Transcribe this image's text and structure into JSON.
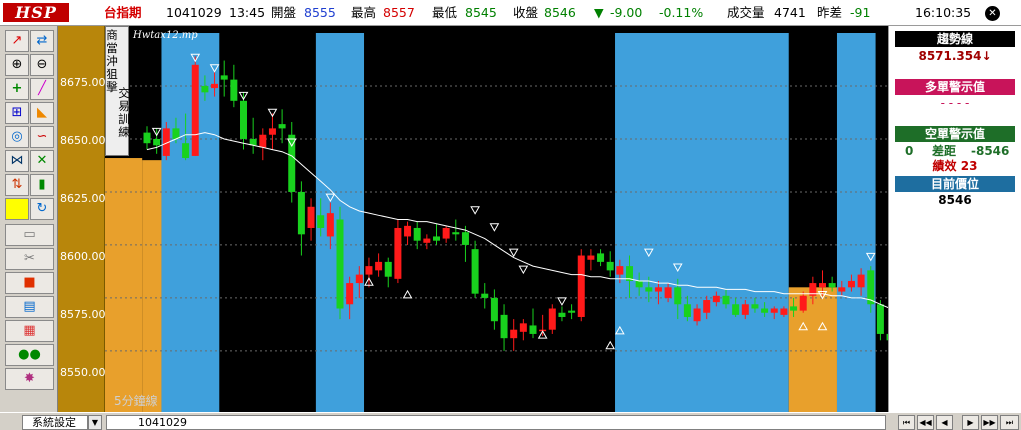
{
  "header": {
    "logo": "HSP",
    "symbol": "台指期",
    "date": "1041029",
    "time": "13:45",
    "open_label": "開盤",
    "open_value": "8555",
    "high_label": "最高",
    "high_value": "8557",
    "low_label": "最低",
    "low_value": "8545",
    "close_label": "收盤",
    "close_value": "8546",
    "change_arrow": "▼",
    "change": "-9.00",
    "change_pct": "-0.11%",
    "volume_label": "成交量",
    "volume_value": "4741",
    "prev_diff_label": "昨差",
    "prev_diff_value": "-91",
    "clock": "16:10:35",
    "close_symbol": "✕"
  },
  "toolbar": {
    "icons": [
      "trend-line-icon",
      "sync-icon",
      "zoom-in-icon",
      "zoom-out-icon",
      "crosshair-icon",
      "line-draw-icon",
      "fibonacci-icon",
      "rectangle-icon",
      "wave-icon",
      "curve-icon",
      "channel-icon",
      "cross-lines-icon",
      "up-down-arrow-icon",
      "candle-icon",
      "color-swatch-icon",
      "refresh-icon",
      "folder-icon",
      "scissors-icon",
      "square-icon",
      "report-icon",
      "grid-icon",
      "users-icon",
      "flash-icon"
    ],
    "yellow_color": "#ffff00"
  },
  "side_menu": {
    "col1": "商當沖狙擊",
    "col2": "交易訓練"
  },
  "chart": {
    "file_label": "Hwtax12.mp",
    "period_label": "5分鐘線",
    "y_ticks": [
      "8675.00",
      "8650.00",
      "8625.00",
      "8600.00",
      "8575.00",
      "8550.00"
    ]
  },
  "chart_data": {
    "type": "candlestick",
    "ylim": [
      8535,
      8700
    ],
    "y_ticks": [
      8675,
      8650,
      8625,
      8600,
      8575,
      8550
    ],
    "candles": [
      {
        "o": 8653,
        "h": 8656,
        "l": 8645,
        "c": 8648
      },
      {
        "o": 8650,
        "h": 8655,
        "l": 8643,
        "c": 8647
      },
      {
        "o": 8642,
        "h": 8658,
        "l": 8640,
        "c": 8655
      },
      {
        "o": 8655,
        "h": 8660,
        "l": 8648,
        "c": 8650
      },
      {
        "o": 8648,
        "h": 8662,
        "l": 8640,
        "c": 8641
      },
      {
        "o": 8642,
        "h": 8689,
        "l": 8642,
        "c": 8685
      },
      {
        "o": 8675,
        "h": 8680,
        "l": 8668,
        "c": 8672
      },
      {
        "o": 8674,
        "h": 8682,
        "l": 8670,
        "c": 8676
      },
      {
        "o": 8680,
        "h": 8687,
        "l": 8670,
        "c": 8678
      },
      {
        "o": 8678,
        "h": 8685,
        "l": 8665,
        "c": 8668
      },
      {
        "o": 8668,
        "h": 8672,
        "l": 8645,
        "c": 8650
      },
      {
        "o": 8650,
        "h": 8660,
        "l": 8643,
        "c": 8647
      },
      {
        "o": 8646,
        "h": 8655,
        "l": 8640,
        "c": 8652
      },
      {
        "o": 8652,
        "h": 8662,
        "l": 8645,
        "c": 8655
      },
      {
        "o": 8657,
        "h": 8664,
        "l": 8648,
        "c": 8655
      },
      {
        "o": 8652,
        "h": 8658,
        "l": 8620,
        "c": 8625
      },
      {
        "o": 8625,
        "h": 8630,
        "l": 8595,
        "c": 8605
      },
      {
        "o": 8608,
        "h": 8622,
        "l": 8602,
        "c": 8618
      },
      {
        "o": 8614,
        "h": 8622,
        "l": 8604,
        "c": 8608
      },
      {
        "o": 8604,
        "h": 8620,
        "l": 8598,
        "c": 8615
      },
      {
        "o": 8612,
        "h": 8618,
        "l": 8565,
        "c": 8570
      },
      {
        "o": 8572,
        "h": 8585,
        "l": 8565,
        "c": 8582
      },
      {
        "o": 8582,
        "h": 8590,
        "l": 8575,
        "c": 8586
      },
      {
        "o": 8586,
        "h": 8594,
        "l": 8580,
        "c": 8590
      },
      {
        "o": 8588,
        "h": 8596,
        "l": 8585,
        "c": 8592
      },
      {
        "o": 8592,
        "h": 8594,
        "l": 8580,
        "c": 8585
      },
      {
        "o": 8584,
        "h": 8612,
        "l": 8582,
        "c": 8608
      },
      {
        "o": 8604,
        "h": 8611,
        "l": 8600,
        "c": 8609
      },
      {
        "o": 8608,
        "h": 8611,
        "l": 8598,
        "c": 8602
      },
      {
        "o": 8601,
        "h": 8605,
        "l": 8598,
        "c": 8603
      },
      {
        "o": 8604,
        "h": 8610,
        "l": 8600,
        "c": 8602
      },
      {
        "o": 8603,
        "h": 8609,
        "l": 8601,
        "c": 8608
      },
      {
        "o": 8606,
        "h": 8612,
        "l": 8602,
        "c": 8605
      },
      {
        "o": 8606,
        "h": 8609,
        "l": 8592,
        "c": 8600
      },
      {
        "o": 8598,
        "h": 8602,
        "l": 8575,
        "c": 8577
      },
      {
        "o": 8577,
        "h": 8582,
        "l": 8570,
        "c": 8575
      },
      {
        "o": 8575,
        "h": 8579,
        "l": 8560,
        "c": 8564
      },
      {
        "o": 8567,
        "h": 8572,
        "l": 8550,
        "c": 8556
      },
      {
        "o": 8556,
        "h": 8565,
        "l": 8550,
        "c": 8560
      },
      {
        "o": 8559,
        "h": 8565,
        "l": 8555,
        "c": 8563
      },
      {
        "o": 8562,
        "h": 8570,
        "l": 8556,
        "c": 8558
      },
      {
        "o": 8560,
        "h": 8567,
        "l": 8557,
        "c": 8560
      },
      {
        "o": 8560,
        "h": 8572,
        "l": 8558,
        "c": 8570
      },
      {
        "o": 8568,
        "h": 8571,
        "l": 8564,
        "c": 8566
      },
      {
        "o": 8569,
        "h": 8572,
        "l": 8565,
        "c": 8568
      },
      {
        "o": 8566,
        "h": 8598,
        "l": 8564,
        "c": 8595
      },
      {
        "o": 8593,
        "h": 8598,
        "l": 8588,
        "c": 8595
      },
      {
        "o": 8596,
        "h": 8598,
        "l": 8590,
        "c": 8592
      },
      {
        "o": 8592,
        "h": 8597,
        "l": 8585,
        "c": 8588
      },
      {
        "o": 8586,
        "h": 8593,
        "l": 8582,
        "c": 8590
      },
      {
        "o": 8590,
        "h": 8595,
        "l": 8575,
        "c": 8583
      },
      {
        "o": 8583,
        "h": 8587,
        "l": 8576,
        "c": 8580
      },
      {
        "o": 8580,
        "h": 8585,
        "l": 8573,
        "c": 8578
      },
      {
        "o": 8578,
        "h": 8583,
        "l": 8572,
        "c": 8580
      },
      {
        "o": 8575,
        "h": 8582,
        "l": 8573,
        "c": 8580
      },
      {
        "o": 8580,
        "h": 8584,
        "l": 8565,
        "c": 8572
      },
      {
        "o": 8572,
        "h": 8576,
        "l": 8564,
        "c": 8566
      },
      {
        "o": 8564,
        "h": 8572,
        "l": 8562,
        "c": 8570
      },
      {
        "o": 8568,
        "h": 8576,
        "l": 8565,
        "c": 8574
      },
      {
        "o": 8573,
        "h": 8578,
        "l": 8571,
        "c": 8576
      },
      {
        "o": 8576,
        "h": 8579,
        "l": 8570,
        "c": 8572
      },
      {
        "o": 8572,
        "h": 8575,
        "l": 8566,
        "c": 8567
      },
      {
        "o": 8567,
        "h": 8574,
        "l": 8565,
        "c": 8572
      },
      {
        "o": 8572,
        "h": 8575,
        "l": 8568,
        "c": 8570
      },
      {
        "o": 8570,
        "h": 8573,
        "l": 8566,
        "c": 8568
      },
      {
        "o": 8568,
        "h": 8571,
        "l": 8565,
        "c": 8570
      },
      {
        "o": 8567,
        "h": 8571,
        "l": 8566,
        "c": 8570
      },
      {
        "o": 8571,
        "h": 8575,
        "l": 8566,
        "c": 8569
      },
      {
        "o": 8569,
        "h": 8578,
        "l": 8568,
        "c": 8576
      },
      {
        "o": 8576,
        "h": 8585,
        "l": 8572,
        "c": 8582
      },
      {
        "o": 8580,
        "h": 8588,
        "l": 8576,
        "c": 8582
      },
      {
        "o": 8582,
        "h": 8585,
        "l": 8578,
        "c": 8580
      },
      {
        "o": 8578,
        "h": 8583,
        "l": 8576,
        "c": 8580
      },
      {
        "o": 8580,
        "h": 8586,
        "l": 8578,
        "c": 8583
      },
      {
        "o": 8580,
        "h": 8589,
        "l": 8576,
        "c": 8586
      },
      {
        "o": 8588,
        "h": 8590,
        "l": 8568,
        "c": 8572
      },
      {
        "o": 8572,
        "h": 8574,
        "l": 8555,
        "c": 8558
      },
      {
        "o": 8558,
        "h": 8562,
        "l": 8550,
        "c": 8555
      },
      {
        "o": 8555,
        "h": 8557,
        "l": 8545,
        "c": 8546
      }
    ],
    "zones": [
      {
        "from": 0,
        "to": 1,
        "color": "#e8a02c",
        "base": 8640
      },
      {
        "from": 2,
        "to": 7,
        "color": "#3fa0dc",
        "base": 8700
      },
      {
        "from": 8,
        "to": 17,
        "color": "#000000",
        "base": 8700
      },
      {
        "from": 18,
        "to": 22,
        "color": "#3fa0dc",
        "base": 8700
      },
      {
        "from": 23,
        "to": 48,
        "color": "#000000",
        "base": 8700
      },
      {
        "from": 49,
        "to": 66,
        "color": "#3fa0dc",
        "base": 8700
      },
      {
        "from": 67,
        "to": 71,
        "color": "#e8a02c",
        "base": 8580
      },
      {
        "from": 72,
        "to": 75,
        "color": "#3fa0dc",
        "base": 8700
      }
    ],
    "sell_markers": [
      {
        "i": 1,
        "v": 8655
      },
      {
        "i": 5,
        "v": 8690
      },
      {
        "i": 7,
        "v": 8685
      },
      {
        "i": 10,
        "v": 8672
      },
      {
        "i": 13,
        "v": 8664
      },
      {
        "i": 15,
        "v": 8650
      },
      {
        "i": 19,
        "v": 8624
      },
      {
        "i": 34,
        "v": 8618
      },
      {
        "i": 36,
        "v": 8610
      },
      {
        "i": 38,
        "v": 8598
      },
      {
        "i": 39,
        "v": 8590
      },
      {
        "i": 43,
        "v": 8575
      },
      {
        "i": 52,
        "v": 8598
      },
      {
        "i": 55,
        "v": 8591
      },
      {
        "i": 70,
        "v": 8578
      },
      {
        "i": 75,
        "v": 8596
      }
    ],
    "buy_markers": [
      {
        "i": 23,
        "v": 8581
      },
      {
        "i": 27,
        "v": 8575
      },
      {
        "i": 41,
        "v": 8556
      },
      {
        "i": 48,
        "v": 8551
      },
      {
        "i": 49,
        "v": 8558
      },
      {
        "i": 68,
        "v": 8560
      },
      {
        "i": 70,
        "v": 8560
      }
    ],
    "ma_line": [
      8645,
      8646,
      8648,
      8650,
      8652,
      8652,
      8653,
      8652,
      8650,
      8649,
      8648,
      8647,
      8646,
      8645,
      8644,
      8642,
      8638,
      8634,
      8630,
      8626,
      8621,
      8618,
      8616,
      8615,
      8614,
      8613,
      8612,
      8612,
      8611,
      8611,
      8610,
      8609,
      8608,
      8607,
      8605,
      8603,
      8600,
      8597,
      8594,
      8592,
      8590,
      8589,
      8588,
      8587,
      8586,
      8586,
      8585,
      8585,
      8584,
      8584,
      8584,
      8583,
      8583,
      8582,
      8582,
      8581,
      8581,
      8580,
      8580,
      8580,
      8579,
      8579,
      8579,
      8578,
      8578,
      8578,
      8577,
      8577,
      8577,
      8577,
      8577,
      8576,
      8576,
      8575,
      8575,
      8574,
      8572,
      8570,
      8568
    ]
  },
  "right_panel": {
    "trend_label": "趨勢線",
    "trend_value": "8571.354↓",
    "long_warn_label": "多單警示值",
    "long_warn_value": "- - - -",
    "short_warn_label": "空單警示值",
    "short_row_qty": "0",
    "short_row_diff_label": "差距",
    "short_row_diff_value": "-8546",
    "perf_label": "績效",
    "perf_value": "23",
    "position_label": "目前價位",
    "position_value": "8546",
    "colors": {
      "trend_bg": "#000000",
      "long_bg": "#c8145a",
      "short_bg": "#1e6e28",
      "position_bg": "#1e6ea0"
    }
  },
  "statusbar": {
    "system_label": "系統設定",
    "date_value": "1041029",
    "nav": [
      "⏮",
      "◀◀",
      "◀",
      "▶",
      "▶▶",
      "⏭"
    ]
  }
}
